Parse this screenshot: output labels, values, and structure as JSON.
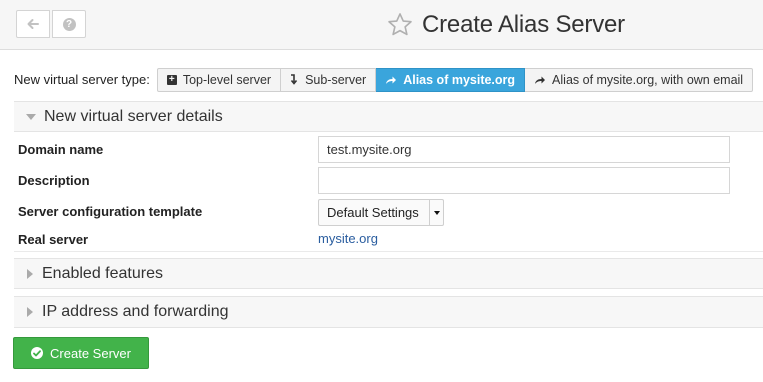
{
  "header": {
    "title": "Create Alias Server",
    "back_icon": "arrow-left-icon",
    "help_icon": "question-circle-icon",
    "favorite_icon": "star-outline-icon"
  },
  "server_type": {
    "label": "New virtual server type:",
    "options": [
      {
        "label": "Top-level server",
        "icon": "plus-square-icon",
        "active": false
      },
      {
        "label": "Sub-server",
        "icon": "arrow-turn-down-icon",
        "active": false
      },
      {
        "label": "Alias of mysite.org",
        "icon": "share-arrow-icon",
        "active": true
      },
      {
        "label": "Alias of mysite.org, with own email",
        "icon": "share-arrow-icon",
        "active": false
      }
    ],
    "accent_color": "#3aa5dc"
  },
  "details": {
    "title": "New virtual server details",
    "domain_label": "Domain name",
    "domain_value": "test.mysite.org",
    "description_label": "Description",
    "description_value": "",
    "template_label": "Server configuration template",
    "template_value": "Default Settings",
    "real_server_label": "Real server",
    "real_server_value": "mysite.org"
  },
  "sections": {
    "features_title": "Enabled features",
    "ip_title": "IP address and forwarding"
  },
  "actions": {
    "create_label": "Create Server",
    "create_color": "#42b34a"
  }
}
